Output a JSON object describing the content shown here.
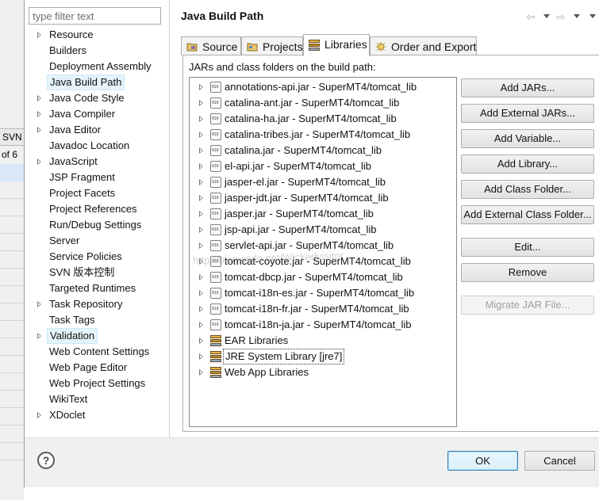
{
  "background": {
    "svn_fragment": "SVN",
    "of_fragment": "of 6"
  },
  "nav": {
    "filter_placeholder": "type filter text",
    "items": [
      {
        "label": "Resource",
        "expandable": true
      },
      {
        "label": "Builders",
        "expandable": false
      },
      {
        "label": "Deployment Assembly",
        "expandable": false
      },
      {
        "label": "Java Build Path",
        "expandable": false,
        "selected": true
      },
      {
        "label": "Java Code Style",
        "expandable": true
      },
      {
        "label": "Java Compiler",
        "expandable": true
      },
      {
        "label": "Java Editor",
        "expandable": true
      },
      {
        "label": "Javadoc Location",
        "expandable": false
      },
      {
        "label": "JavaScript",
        "expandable": true
      },
      {
        "label": "JSP Fragment",
        "expandable": false
      },
      {
        "label": "Project Facets",
        "expandable": false
      },
      {
        "label": "Project References",
        "expandable": false
      },
      {
        "label": "Run/Debug Settings",
        "expandable": false
      },
      {
        "label": "Server",
        "expandable": false
      },
      {
        "label": "Service Policies",
        "expandable": false
      },
      {
        "label": "SVN 版本控制",
        "expandable": false
      },
      {
        "label": "Targeted Runtimes",
        "expandable": false
      },
      {
        "label": "Task Repository",
        "expandable": true
      },
      {
        "label": "Task Tags",
        "expandable": false
      },
      {
        "label": "Validation",
        "expandable": true,
        "selected": true
      },
      {
        "label": "Web Content Settings",
        "expandable": false
      },
      {
        "label": "Web Page Editor",
        "expandable": false
      },
      {
        "label": "Web Project Settings",
        "expandable": false
      },
      {
        "label": "WikiText",
        "expandable": false
      },
      {
        "label": "XDoclet",
        "expandable": true
      }
    ]
  },
  "header": {
    "title": "Java Build Path"
  },
  "tabs": [
    {
      "label": "Source",
      "icon": "source-folder-icon",
      "active": false
    },
    {
      "label": "Projects",
      "icon": "project-folder-icon",
      "active": false
    },
    {
      "label": "Libraries",
      "icon": "libraries-icon",
      "active": true
    },
    {
      "label": "Order and Export",
      "icon": "order-export-icon",
      "active": false
    }
  ],
  "panel": {
    "description": "JARs and class folders on the build path:",
    "entries": [
      {
        "label": "annotations-api.jar - SuperMT4/tomcat_lib",
        "icon": "jar-icon"
      },
      {
        "label": "catalina-ant.jar - SuperMT4/tomcat_lib",
        "icon": "jar-icon"
      },
      {
        "label": "catalina-ha.jar - SuperMT4/tomcat_lib",
        "icon": "jar-icon"
      },
      {
        "label": "catalina-tribes.jar - SuperMT4/tomcat_lib",
        "icon": "jar-icon"
      },
      {
        "label": "catalina.jar - SuperMT4/tomcat_lib",
        "icon": "jar-icon"
      },
      {
        "label": "el-api.jar - SuperMT4/tomcat_lib",
        "icon": "jar-icon"
      },
      {
        "label": "jasper-el.jar - SuperMT4/tomcat_lib",
        "icon": "jar-icon"
      },
      {
        "label": "jasper-jdt.jar - SuperMT4/tomcat_lib",
        "icon": "jar-icon"
      },
      {
        "label": "jasper.jar - SuperMT4/tomcat_lib",
        "icon": "jar-icon"
      },
      {
        "label": "jsp-api.jar - SuperMT4/tomcat_lib",
        "icon": "jar-icon"
      },
      {
        "label": "servlet-api.jar - SuperMT4/tomcat_lib",
        "icon": "jar-icon"
      },
      {
        "label": "tomcat-coyote.jar - SuperMT4/tomcat_lib",
        "icon": "jar-icon"
      },
      {
        "label": "tomcat-dbcp.jar - SuperMT4/tomcat_lib",
        "icon": "jar-icon"
      },
      {
        "label": "tomcat-i18n-es.jar - SuperMT4/tomcat_lib",
        "icon": "jar-icon"
      },
      {
        "label": "tomcat-i18n-fr.jar - SuperMT4/tomcat_lib",
        "icon": "jar-icon"
      },
      {
        "label": "tomcat-i18n-ja.jar - SuperMT4/tomcat_lib",
        "icon": "jar-icon"
      },
      {
        "label": "EAR Libraries",
        "icon": "library-icon"
      },
      {
        "label": "JRE System Library [jre7]",
        "icon": "library-icon",
        "selected": true
      },
      {
        "label": "Web App Libraries",
        "icon": "library-icon"
      }
    ]
  },
  "buttons": {
    "add_jars": "Add JARs...",
    "add_external_jars": "Add External JARs...",
    "add_variable": "Add Variable...",
    "add_library": "Add Library...",
    "add_class_folder": "Add Class Folder...",
    "add_external_class_folder": "Add External Class Folder...",
    "edit": "Edit...",
    "remove": "Remove",
    "migrate_jar": "Migrate JAR File..."
  },
  "footer": {
    "help": "?",
    "ok": "OK",
    "cancel": "Cancel"
  },
  "watermark": "http://blog.csdn.net/Wickedvisitor"
}
